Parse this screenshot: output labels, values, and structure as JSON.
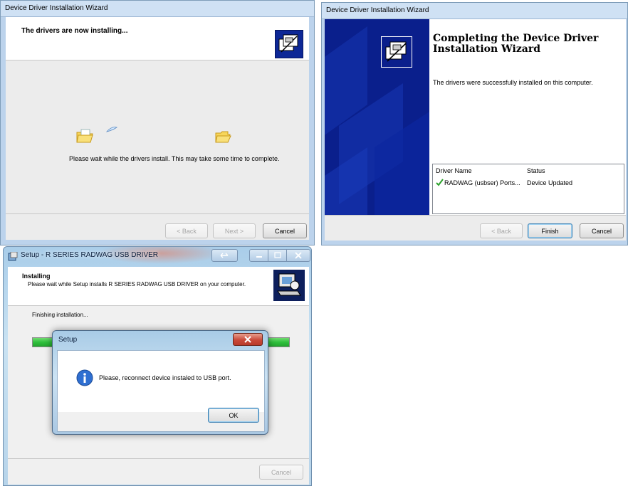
{
  "window1": {
    "title": "Device Driver Installation Wizard",
    "heading": "The drivers are now installing...",
    "message": "Please wait while the drivers install. This may take some time to complete.",
    "buttons": {
      "back": "< Back",
      "next": "Next >",
      "cancel": "Cancel"
    }
  },
  "window2": {
    "title": "Device Driver Installation Wizard",
    "heading": "Completing the Device Driver Installation Wizard",
    "message": "The drivers were successfully installed on this computer.",
    "table": {
      "columns": [
        "Driver Name",
        "Status"
      ],
      "rows": [
        {
          "name": "RADWAG (usbser) Ports...",
          "status": "Device Updated"
        }
      ]
    },
    "buttons": {
      "back": "< Back",
      "finish": "Finish",
      "cancel": "Cancel"
    }
  },
  "window3": {
    "title": "Setup - R SERIES RADWAG USB DRIVER",
    "heading": "Installing",
    "subheading": "Please wait while Setup installs R SERIES RADWAG USB DRIVER on your computer.",
    "status": "Finishing installation...",
    "buttons": {
      "cancel": "Cancel"
    }
  },
  "dialog": {
    "title": "Setup",
    "message": "Please, reconnect device instaled to USB port.",
    "buttons": {
      "ok": "OK"
    }
  },
  "colors": {
    "wizard_sidebar": "#0a1f8c",
    "progress_green": "#2fbf3c",
    "aero_glass": "#bcd8ee",
    "close_red": "#c94a3a"
  }
}
